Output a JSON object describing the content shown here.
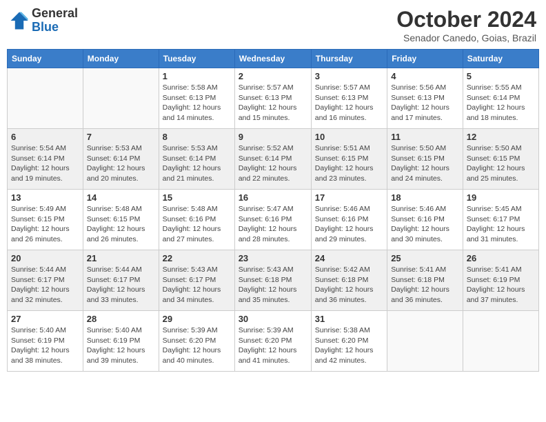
{
  "header": {
    "logo_general": "General",
    "logo_blue": "Blue",
    "month_title": "October 2024",
    "location": "Senador Canedo, Goias, Brazil"
  },
  "days_of_week": [
    "Sunday",
    "Monday",
    "Tuesday",
    "Wednesday",
    "Thursday",
    "Friday",
    "Saturday"
  ],
  "weeks": [
    [
      {
        "day": "",
        "sunrise": "",
        "sunset": "",
        "daylight": ""
      },
      {
        "day": "",
        "sunrise": "",
        "sunset": "",
        "daylight": ""
      },
      {
        "day": "1",
        "sunrise": "Sunrise: 5:58 AM",
        "sunset": "Sunset: 6:13 PM",
        "daylight": "Daylight: 12 hours and 14 minutes."
      },
      {
        "day": "2",
        "sunrise": "Sunrise: 5:57 AM",
        "sunset": "Sunset: 6:13 PM",
        "daylight": "Daylight: 12 hours and 15 minutes."
      },
      {
        "day": "3",
        "sunrise": "Sunrise: 5:57 AM",
        "sunset": "Sunset: 6:13 PM",
        "daylight": "Daylight: 12 hours and 16 minutes."
      },
      {
        "day": "4",
        "sunrise": "Sunrise: 5:56 AM",
        "sunset": "Sunset: 6:13 PM",
        "daylight": "Daylight: 12 hours and 17 minutes."
      },
      {
        "day": "5",
        "sunrise": "Sunrise: 5:55 AM",
        "sunset": "Sunset: 6:14 PM",
        "daylight": "Daylight: 12 hours and 18 minutes."
      }
    ],
    [
      {
        "day": "6",
        "sunrise": "Sunrise: 5:54 AM",
        "sunset": "Sunset: 6:14 PM",
        "daylight": "Daylight: 12 hours and 19 minutes."
      },
      {
        "day": "7",
        "sunrise": "Sunrise: 5:53 AM",
        "sunset": "Sunset: 6:14 PM",
        "daylight": "Daylight: 12 hours and 20 minutes."
      },
      {
        "day": "8",
        "sunrise": "Sunrise: 5:53 AM",
        "sunset": "Sunset: 6:14 PM",
        "daylight": "Daylight: 12 hours and 21 minutes."
      },
      {
        "day": "9",
        "sunrise": "Sunrise: 5:52 AM",
        "sunset": "Sunset: 6:14 PM",
        "daylight": "Daylight: 12 hours and 22 minutes."
      },
      {
        "day": "10",
        "sunrise": "Sunrise: 5:51 AM",
        "sunset": "Sunset: 6:15 PM",
        "daylight": "Daylight: 12 hours and 23 minutes."
      },
      {
        "day": "11",
        "sunrise": "Sunrise: 5:50 AM",
        "sunset": "Sunset: 6:15 PM",
        "daylight": "Daylight: 12 hours and 24 minutes."
      },
      {
        "day": "12",
        "sunrise": "Sunrise: 5:50 AM",
        "sunset": "Sunset: 6:15 PM",
        "daylight": "Daylight: 12 hours and 25 minutes."
      }
    ],
    [
      {
        "day": "13",
        "sunrise": "Sunrise: 5:49 AM",
        "sunset": "Sunset: 6:15 PM",
        "daylight": "Daylight: 12 hours and 26 minutes."
      },
      {
        "day": "14",
        "sunrise": "Sunrise: 5:48 AM",
        "sunset": "Sunset: 6:15 PM",
        "daylight": "Daylight: 12 hours and 26 minutes."
      },
      {
        "day": "15",
        "sunrise": "Sunrise: 5:48 AM",
        "sunset": "Sunset: 6:16 PM",
        "daylight": "Daylight: 12 hours and 27 minutes."
      },
      {
        "day": "16",
        "sunrise": "Sunrise: 5:47 AM",
        "sunset": "Sunset: 6:16 PM",
        "daylight": "Daylight: 12 hours and 28 minutes."
      },
      {
        "day": "17",
        "sunrise": "Sunrise: 5:46 AM",
        "sunset": "Sunset: 6:16 PM",
        "daylight": "Daylight: 12 hours and 29 minutes."
      },
      {
        "day": "18",
        "sunrise": "Sunrise: 5:46 AM",
        "sunset": "Sunset: 6:16 PM",
        "daylight": "Daylight: 12 hours and 30 minutes."
      },
      {
        "day": "19",
        "sunrise": "Sunrise: 5:45 AM",
        "sunset": "Sunset: 6:17 PM",
        "daylight": "Daylight: 12 hours and 31 minutes."
      }
    ],
    [
      {
        "day": "20",
        "sunrise": "Sunrise: 5:44 AM",
        "sunset": "Sunset: 6:17 PM",
        "daylight": "Daylight: 12 hours and 32 minutes."
      },
      {
        "day": "21",
        "sunrise": "Sunrise: 5:44 AM",
        "sunset": "Sunset: 6:17 PM",
        "daylight": "Daylight: 12 hours and 33 minutes."
      },
      {
        "day": "22",
        "sunrise": "Sunrise: 5:43 AM",
        "sunset": "Sunset: 6:17 PM",
        "daylight": "Daylight: 12 hours and 34 minutes."
      },
      {
        "day": "23",
        "sunrise": "Sunrise: 5:43 AM",
        "sunset": "Sunset: 6:18 PM",
        "daylight": "Daylight: 12 hours and 35 minutes."
      },
      {
        "day": "24",
        "sunrise": "Sunrise: 5:42 AM",
        "sunset": "Sunset: 6:18 PM",
        "daylight": "Daylight: 12 hours and 36 minutes."
      },
      {
        "day": "25",
        "sunrise": "Sunrise: 5:41 AM",
        "sunset": "Sunset: 6:18 PM",
        "daylight": "Daylight: 12 hours and 36 minutes."
      },
      {
        "day": "26",
        "sunrise": "Sunrise: 5:41 AM",
        "sunset": "Sunset: 6:19 PM",
        "daylight": "Daylight: 12 hours and 37 minutes."
      }
    ],
    [
      {
        "day": "27",
        "sunrise": "Sunrise: 5:40 AM",
        "sunset": "Sunset: 6:19 PM",
        "daylight": "Daylight: 12 hours and 38 minutes."
      },
      {
        "day": "28",
        "sunrise": "Sunrise: 5:40 AM",
        "sunset": "Sunset: 6:19 PM",
        "daylight": "Daylight: 12 hours and 39 minutes."
      },
      {
        "day": "29",
        "sunrise": "Sunrise: 5:39 AM",
        "sunset": "Sunset: 6:20 PM",
        "daylight": "Daylight: 12 hours and 40 minutes."
      },
      {
        "day": "30",
        "sunrise": "Sunrise: 5:39 AM",
        "sunset": "Sunset: 6:20 PM",
        "daylight": "Daylight: 12 hours and 41 minutes."
      },
      {
        "day": "31",
        "sunrise": "Sunrise: 5:38 AM",
        "sunset": "Sunset: 6:20 PM",
        "daylight": "Daylight: 12 hours and 42 minutes."
      },
      {
        "day": "",
        "sunrise": "",
        "sunset": "",
        "daylight": ""
      },
      {
        "day": "",
        "sunrise": "",
        "sunset": "",
        "daylight": ""
      }
    ]
  ]
}
